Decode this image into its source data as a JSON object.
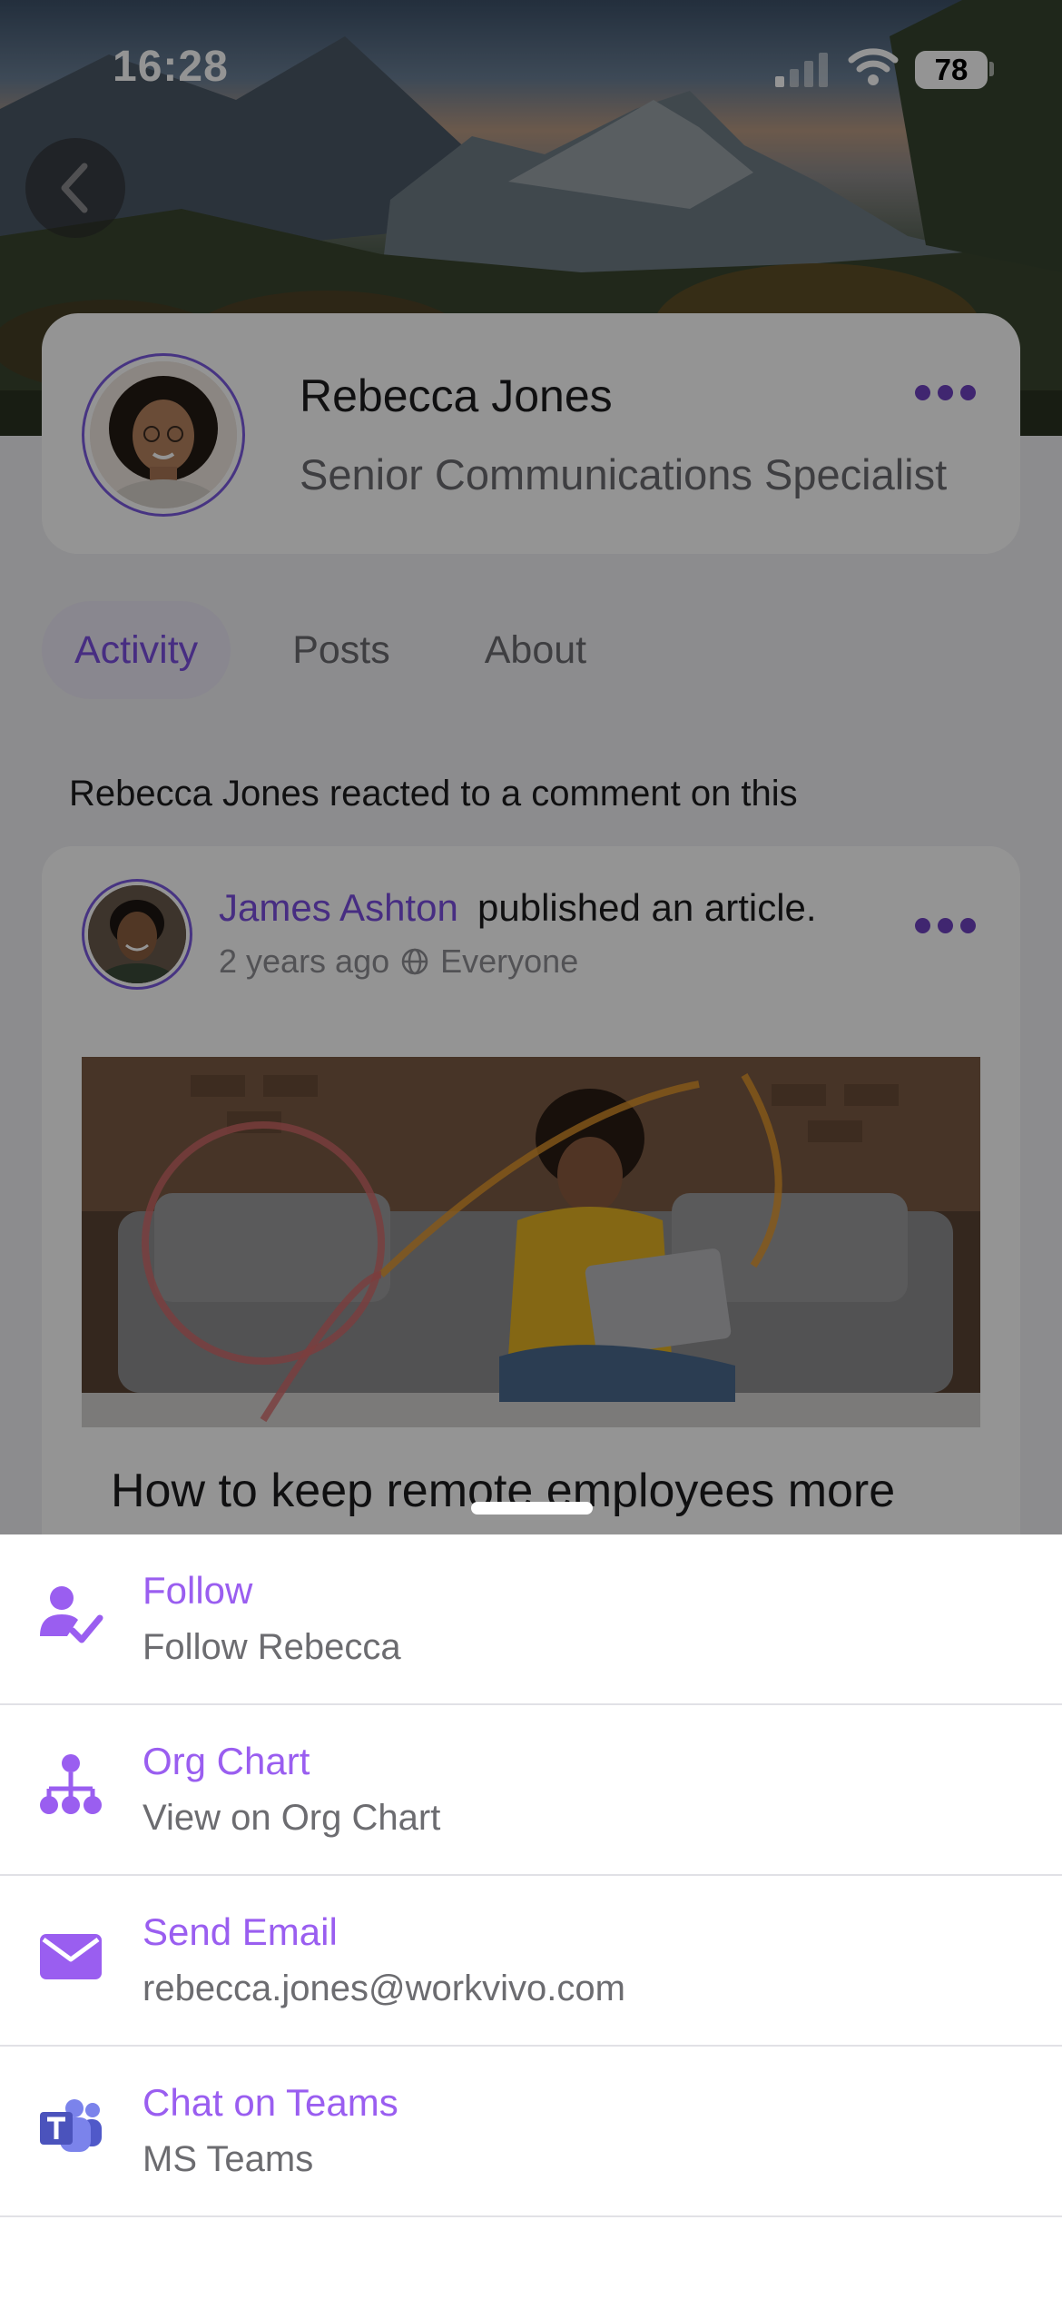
{
  "status_bar": {
    "time": "16:28",
    "battery": "78"
  },
  "profile": {
    "name": "Rebecca Jones",
    "role": "Senior Communications Specialist"
  },
  "tabs": [
    {
      "label": "Activity",
      "active": true
    },
    {
      "label": "Posts",
      "active": false
    },
    {
      "label": "About",
      "active": false
    }
  ],
  "activity": {
    "actor": "Rebecca Jones",
    "text": " reacted to a comment on this"
  },
  "post": {
    "author": "James Ashton",
    "action": "published an article.",
    "time": "2 years ago",
    "audience": "Everyone",
    "title": "How to keep remote employees more"
  },
  "sheet": {
    "items": [
      {
        "title": "Follow",
        "subtitle": "Follow Rebecca",
        "icon": "follow-user-icon"
      },
      {
        "title": "Org Chart",
        "subtitle": "View on Org Chart",
        "icon": "org-chart-icon"
      },
      {
        "title": "Send Email",
        "subtitle": "rebecca.jones@workvivo.com",
        "icon": "envelope-icon"
      },
      {
        "title": "Chat on Teams",
        "subtitle": "MS Teams",
        "icon": "ms-teams-icon"
      }
    ]
  },
  "colors": {
    "accent": "#7a4ee0",
    "sheet_accent": "#9a5ef0",
    "ring": "#7a5be0"
  }
}
